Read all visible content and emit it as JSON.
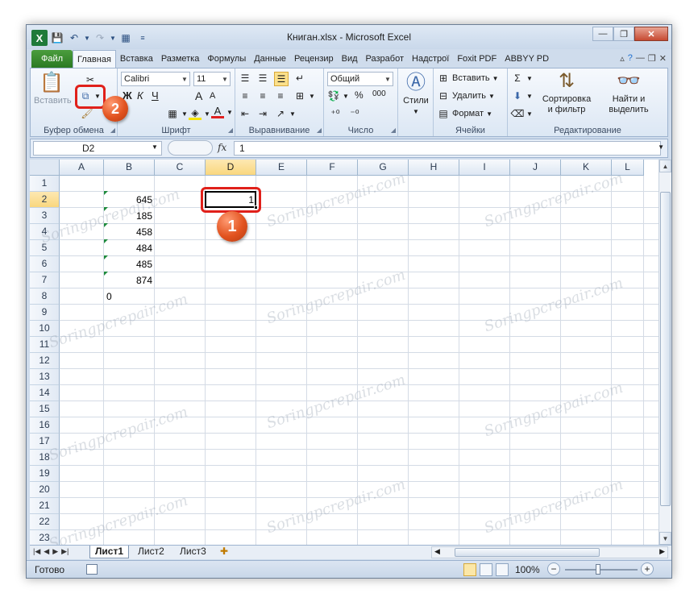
{
  "window": {
    "title": "Книгaн.xlsx - Microsoft Excel"
  },
  "quick_access": {
    "app_icon": "X"
  },
  "window_controls": {
    "minimize": "—",
    "restore": "❐",
    "close": "✕"
  },
  "ribbon_tabs": [
    "Файл",
    "Главная",
    "Вставка",
    "Разметка",
    "Формулы",
    "Данные",
    "Рецензир",
    "Вид",
    "Разработ",
    "Надстрої",
    "Foxit PDF",
    "ABBYY PD"
  ],
  "ribbon": {
    "clipboard": {
      "label": "Буфер обмена",
      "paste": "Вставить"
    },
    "font": {
      "label": "Шрифт",
      "name": "Calibri",
      "size": "11",
      "bold": "Ж",
      "italic": "К",
      "underline": "Ч",
      "grow": "A",
      "shrink": "A"
    },
    "alignment": {
      "label": "Выравнивание"
    },
    "number": {
      "label": "Число",
      "format": "Общий",
      "percent": "%",
      "thousands": "000"
    },
    "styles": {
      "label": "Стили"
    },
    "cells": {
      "label": "Ячейки",
      "insert": "Вставить",
      "delete": "Удалить",
      "format": "Формат"
    },
    "editing": {
      "label": "Редактирование",
      "sort_line1": "Сортировка",
      "sort_line2": "и фильтр",
      "find_line1": "Найти и",
      "find_line2": "выделить"
    }
  },
  "formula_bar": {
    "name_box": "D2",
    "fx": "fx",
    "content": "1"
  },
  "columns": [
    "A",
    "B",
    "C",
    "D",
    "E",
    "F",
    "G",
    "H",
    "I",
    "J",
    "K",
    "L"
  ],
  "selected_column": "D",
  "rows": [
    "1",
    "2",
    "3",
    "4",
    "5",
    "6",
    "7",
    "8",
    "9",
    "10",
    "11",
    "12",
    "13",
    "14",
    "15",
    "16",
    "17",
    "18",
    "19",
    "20",
    "21",
    "22",
    "23"
  ],
  "selected_row": "2",
  "cells": {
    "B2": "645",
    "B3": "185",
    "B4": "458",
    "B5": "484",
    "B6": "485",
    "B7": "874",
    "B8": "0",
    "D2": "1"
  },
  "callouts": {
    "one": "1",
    "two": "2"
  },
  "watermark": "Soringpcrepair.com",
  "sheets": [
    "Лист1",
    "Лист2",
    "Лист3"
  ],
  "status": {
    "ready": "Готово",
    "zoom": "100%",
    "minus": "−",
    "plus": "+"
  }
}
